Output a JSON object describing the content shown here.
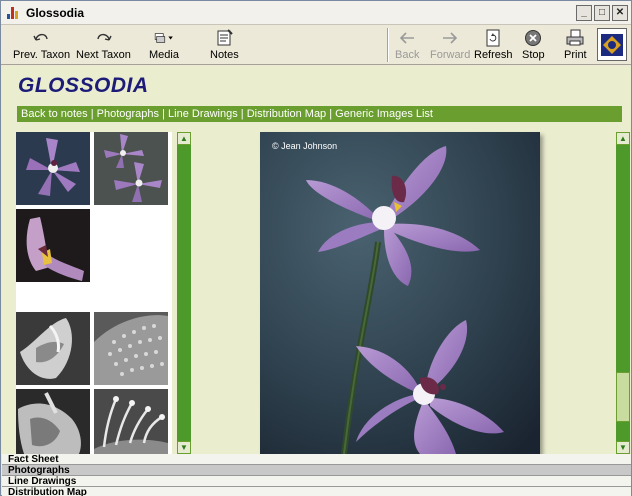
{
  "window": {
    "title": "Glossodia"
  },
  "toolbar": {
    "prev_taxon": "Prev. Taxon",
    "next_taxon": "Next Taxon",
    "media": "Media",
    "notes": "Notes",
    "back": "Back",
    "forward": "Forward",
    "refresh": "Refresh",
    "stop": "Stop",
    "print": "Print"
  },
  "page": {
    "heading": "GLOSSODIA",
    "nav_links": [
      "Back to notes",
      "Photographs",
      "Line Drawings",
      "Distribution Map",
      "Generic Images List"
    ],
    "nav_separator": " | ",
    "photo_credit": "© Jean Johnson"
  },
  "bottom_tabs": [
    {
      "label": "Fact Sheet",
      "selected": false
    },
    {
      "label": "Photographs",
      "selected": true
    },
    {
      "label": "Line Drawings",
      "selected": false
    },
    {
      "label": "Distribution Map",
      "selected": false
    }
  ],
  "colors": {
    "accent_green": "#6a9e2e",
    "heading_blue": "#1c1c78",
    "content_bg": "#ebedcf"
  }
}
